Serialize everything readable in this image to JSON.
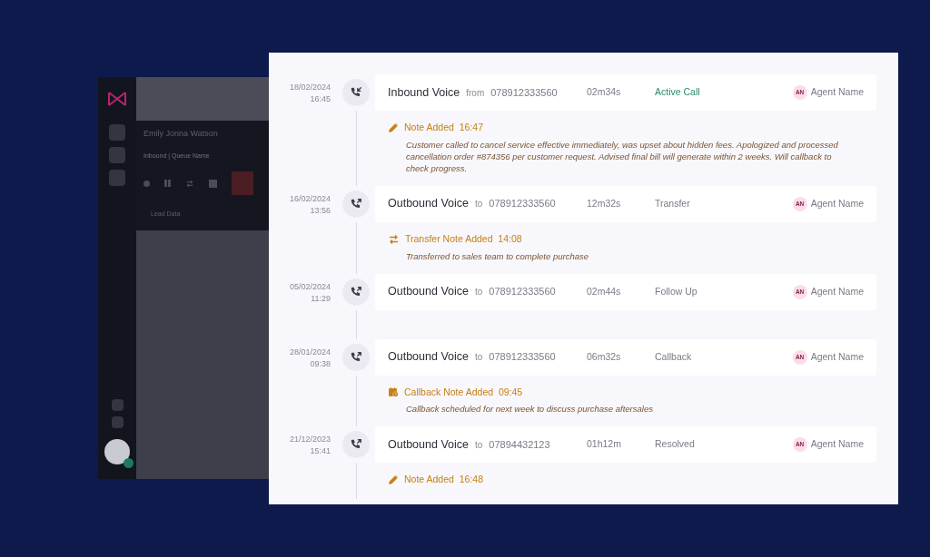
{
  "background_app": {
    "contact_name": "Emily Jonna Watson",
    "queue": "Inbound | Queue Name",
    "tab": "Lead Data"
  },
  "timeline": [
    {
      "date": "18/02/2024",
      "time": "16:45",
      "kind": "inbound",
      "title": "Inbound Voice",
      "preposition": "from",
      "number": "078912333560",
      "duration": "02m34s",
      "status": "Active Call",
      "active": true,
      "agent_initials": "AN",
      "agent": "Agent Name",
      "note": {
        "kind": "note",
        "title": "Note Added",
        "time": "16:47",
        "text": "Customer called to cancel service effective immediately, was upset about hidden fees. Apologized and processed cancellation order #874356 per customer request. Advised final bill will generate within 2 weeks. Will callback to check progress."
      }
    },
    {
      "date": "16/02/2024",
      "time": "13:56",
      "kind": "outbound",
      "title": "Outbound Voice",
      "preposition": "to",
      "number": "078912333560",
      "duration": "12m32s",
      "status": "Transfer",
      "active": false,
      "agent_initials": "AN",
      "agent": "Agent Name",
      "note": {
        "kind": "transfer",
        "title": "Transfer Note Added",
        "time": "14:08",
        "text": "Transferred to sales team to complete purchase"
      }
    },
    {
      "date": "05/02/2024",
      "time": "11:29",
      "kind": "outbound",
      "title": "Outbound Voice",
      "preposition": "to",
      "number": "078912333560",
      "duration": "02m44s",
      "status": "Follow Up",
      "active": false,
      "agent_initials": "AN",
      "agent": "Agent Name"
    },
    {
      "date": "28/01/2024",
      "time": "09:38",
      "kind": "outbound",
      "title": "Outbound Voice",
      "preposition": "to",
      "number": "078912333560",
      "duration": "06m32s",
      "status": "Callback",
      "active": false,
      "agent_initials": "AN",
      "agent": "Agent Name",
      "note": {
        "kind": "callback",
        "title": "Callback Note Added",
        "time": "09:45",
        "text": "Callback scheduled for next week to discuss purchase aftersales"
      }
    },
    {
      "date": "21/12/2023",
      "time": "15:41",
      "kind": "outbound",
      "title": "Outbound Voice",
      "preposition": "to",
      "number": "07894432123",
      "duration": "01h12m",
      "status": "Resolved",
      "active": false,
      "agent_initials": "AN",
      "agent": "Agent Name",
      "note": {
        "kind": "note",
        "title": "Note Added",
        "time": "16:48"
      }
    }
  ]
}
